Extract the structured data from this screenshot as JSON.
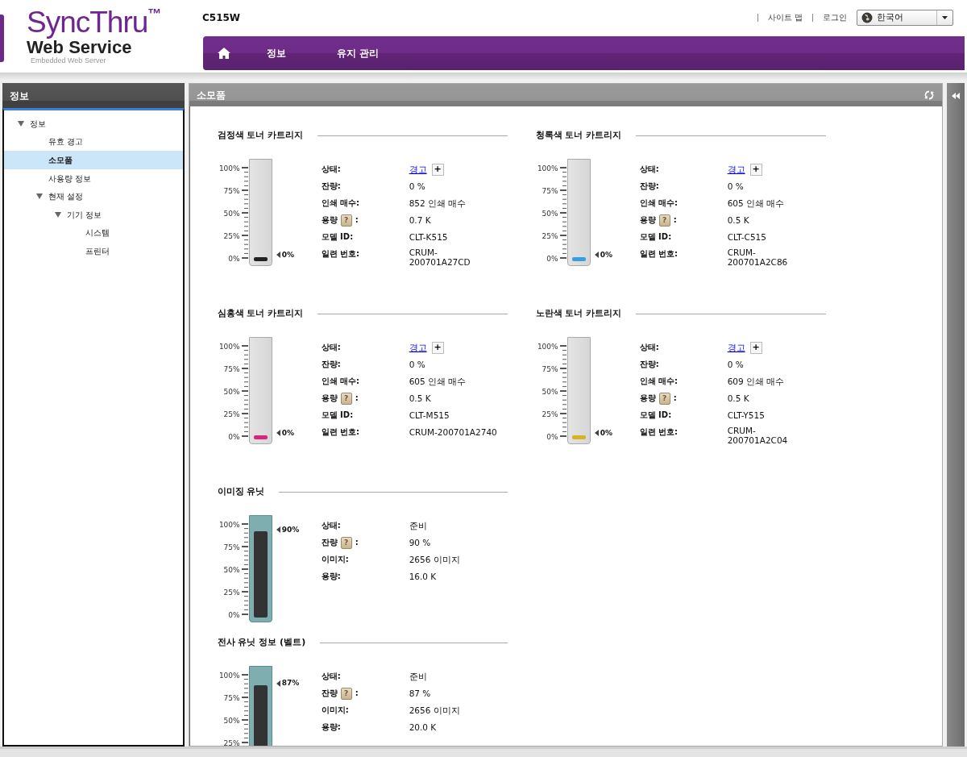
{
  "logo": {
    "title": "SyncThru",
    "trademark": "™",
    "subtitle": "Web Service",
    "tagline": "Embedded Web Server"
  },
  "model": "C515W",
  "top_links": [
    {
      "label": "사이트 맵"
    },
    {
      "label": "로그인"
    }
  ],
  "language": {
    "value": "한국어"
  },
  "nav": [
    {
      "label": "정보",
      "selected": false
    },
    {
      "label": "유지 관리",
      "selected": false
    }
  ],
  "sidebar": {
    "title": "정보",
    "items": [
      {
        "label": "정보",
        "selected": false,
        "expanded": true,
        "children": [
          {
            "label": "유효 경고",
            "selected": false
          },
          {
            "label": "소모품",
            "selected": true
          },
          {
            "label": "사용량 정보",
            "selected": false
          },
          {
            "label": "현재 설정",
            "selected": false,
            "expanded": true,
            "children": [
              {
                "label": "기기 정보",
                "selected": false,
                "expanded": true,
                "children": [
                  {
                    "label": "시스템",
                    "selected": false
                  },
                  {
                    "label": "프린터",
                    "selected": false
                  }
                ]
              }
            ]
          }
        ]
      }
    ]
  },
  "content": {
    "title": "소모품",
    "sections": [
      {
        "kind": "toner",
        "title": "검정색 토너 카트리지",
        "color": "#222222",
        "level": 0,
        "reading": "0%",
        "scale": [
          "100%",
          "75%",
          "50%",
          "25%",
          "0%"
        ],
        "rows": [
          {
            "label": "상태:",
            "value": "경고",
            "link": true,
            "expand_button": "+"
          },
          {
            "label": "잔량:",
            "value": "0 %"
          },
          {
            "label": "인쇄 매수:",
            "value": "852 인쇄 매수"
          },
          {
            "label": "용량",
            "help": "?",
            "label_end": ":",
            "value": "0.7 K"
          },
          {
            "label": "모델 ID:",
            "value": "CLT-K515"
          },
          {
            "label": "일련 번호:",
            "value": "CRUM-\n200701A27CD"
          }
        ]
      },
      {
        "kind": "toner",
        "title": "청록색 토너 카트리지",
        "color": "#3a9fe0",
        "level": 0,
        "reading": "0%",
        "scale": [
          "100%",
          "75%",
          "50%",
          "25%",
          "0%"
        ],
        "rows": [
          {
            "label": "상태:",
            "value": "경고",
            "link": true,
            "expand_button": "+"
          },
          {
            "label": "잔량:",
            "value": "0 %"
          },
          {
            "label": "인쇄 매수:",
            "value": "605 인쇄 매수"
          },
          {
            "label": "용량",
            "help": "?",
            "label_end": ":",
            "value": "0.5 K"
          },
          {
            "label": "모델 ID:",
            "value": "CLT-C515"
          },
          {
            "label": "일련 번호:",
            "value": "CRUM-\n200701A2C86"
          }
        ]
      },
      {
        "kind": "toner",
        "title": "심홍색 토너 카트리지",
        "color": "#d6267f",
        "level": 0,
        "reading": "0%",
        "scale": [
          "100%",
          "75%",
          "50%",
          "25%",
          "0%"
        ],
        "rows": [
          {
            "label": "상태:",
            "value": "경고",
            "link": true,
            "expand_button": "+"
          },
          {
            "label": "잔량:",
            "value": "0 %"
          },
          {
            "label": "인쇄 매수:",
            "value": "605 인쇄 매수"
          },
          {
            "label": "용량",
            "help": "?",
            "label_end": ":",
            "value": "0.5 K"
          },
          {
            "label": "모델 ID:",
            "value": "CLT-M515"
          },
          {
            "label": "일련 번호:",
            "value": "CRUM-200701A2740"
          }
        ]
      },
      {
        "kind": "toner",
        "title": "노란색 토너 카트리지",
        "color": "#d9b224",
        "level": 0,
        "reading": "0%",
        "scale": [
          "100%",
          "75%",
          "50%",
          "25%",
          "0%"
        ],
        "rows": [
          {
            "label": "상태:",
            "value": "경고",
            "link": true,
            "expand_button": "+"
          },
          {
            "label": "잔량:",
            "value": "0 %"
          },
          {
            "label": "인쇄 매수:",
            "value": "609 인쇄 매수"
          },
          {
            "label": "용량",
            "help": "?",
            "label_end": ":",
            "value": "0.5 K"
          },
          {
            "label": "모델 ID:",
            "value": "CLT-Y515"
          },
          {
            "label": "일련 번호:",
            "value": "CRUM-\n200701A2C04"
          }
        ]
      },
      {
        "kind": "unit",
        "title": "이미징 유닛",
        "color": "#333333",
        "level": 0.9,
        "reading": "90%",
        "scale": [
          "100%",
          "75%",
          "50%",
          "25%",
          "0%"
        ],
        "rows": [
          {
            "label": "상태:",
            "value": "준비"
          },
          {
            "label": "잔량",
            "help": "?",
            "label_end": ":",
            "value": "90 %"
          },
          {
            "label": "이미지:",
            "value": "2656 이미지"
          },
          {
            "label": "용량:",
            "value": "16.0 K"
          }
        ]
      },
      {
        "kind": "unit",
        "title": "전사 유닛 정보 (벨트)",
        "color": "#333333",
        "level": 0.87,
        "reading": "87%",
        "scale": [
          "100%",
          "75%",
          "50%",
          "25%"
        ],
        "rows": [
          {
            "label": "상태:",
            "value": "준비"
          },
          {
            "label": "잔량",
            "help": "?",
            "label_end": ":",
            "value": "87 %"
          },
          {
            "label": "이미지:",
            "value": "2656 이미지"
          },
          {
            "label": "용량:",
            "value": "20.0 K"
          }
        ]
      }
    ]
  }
}
